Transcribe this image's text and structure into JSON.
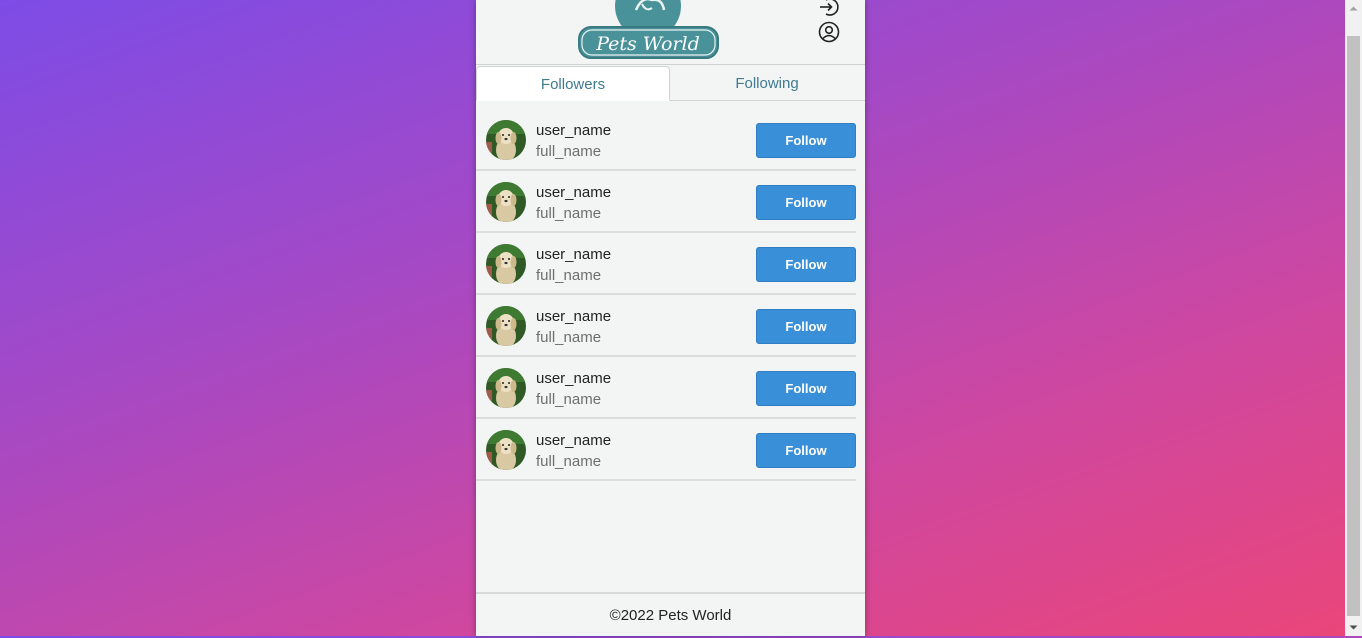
{
  "brand": {
    "logo_text": "Pets World"
  },
  "header": {
    "icons": [
      "login-icon",
      "user-profile-icon"
    ]
  },
  "tabs": [
    {
      "label": "Followers",
      "active": true
    },
    {
      "label": "Following",
      "active": false
    }
  ],
  "users": [
    {
      "user_name": "user_name",
      "full_name": "full_name",
      "button": "Follow"
    },
    {
      "user_name": "user_name",
      "full_name": "full_name",
      "button": "Follow"
    },
    {
      "user_name": "user_name",
      "full_name": "full_name",
      "button": "Follow"
    },
    {
      "user_name": "user_name",
      "full_name": "full_name",
      "button": "Follow"
    },
    {
      "user_name": "user_name",
      "full_name": "full_name",
      "button": "Follow"
    },
    {
      "user_name": "user_name",
      "full_name": "full_name",
      "button": "Follow"
    }
  ],
  "footer": {
    "text": "©2022 Pets World"
  },
  "colors": {
    "accent": "#3a8fd9",
    "logo": "#4a9299",
    "tab_text": "#3e7a90"
  }
}
